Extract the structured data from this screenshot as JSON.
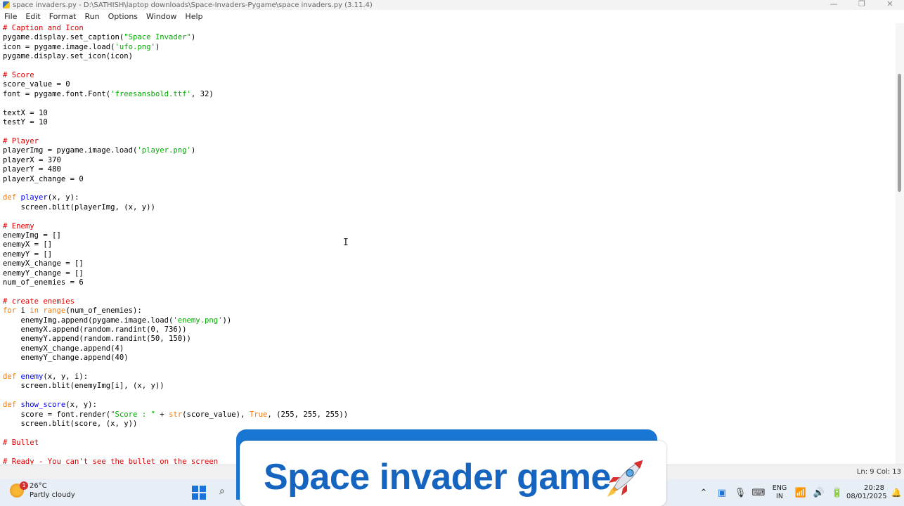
{
  "window": {
    "title": "space invaders.py - D:\\SATHISH\\laptop downloads\\Space-Invaders-Pygame\\space invaders.py (3.11.4)",
    "controls": [
      "—",
      "❐",
      "✕"
    ]
  },
  "menu": [
    "File",
    "Edit",
    "Format",
    "Run",
    "Options",
    "Window",
    "Help"
  ],
  "code_lines": [
    [
      [
        "cm",
        "# Caption and Icon"
      ]
    ],
    [
      [
        "",
        "pygame.display.set_caption("
      ],
      [
        "st",
        "\"Space Invader\""
      ],
      [
        "",
        ")"
      ]
    ],
    [
      [
        "",
        "icon = pygame.image.load("
      ],
      [
        "st",
        "'ufo.png'"
      ],
      [
        "",
        ")"
      ]
    ],
    [
      [
        "",
        "pygame.display.set_icon(icon)"
      ]
    ],
    [],
    [
      [
        "cm",
        "# Score"
      ]
    ],
    [
      [
        "",
        "score_value = 0"
      ]
    ],
    [
      [
        "",
        "font = pygame.font.Font("
      ],
      [
        "st",
        "'freesansbold.ttf'"
      ],
      [
        "",
        ", 32)"
      ]
    ],
    [],
    [
      [
        "",
        "textX = 10"
      ]
    ],
    [
      [
        "",
        "testY = 10"
      ]
    ],
    [],
    [
      [
        "cm",
        "# Player"
      ]
    ],
    [
      [
        "",
        "playerImg = pygame.image.load("
      ],
      [
        "st",
        "'player.png'"
      ],
      [
        "",
        ")"
      ]
    ],
    [
      [
        "",
        "playerX = 370"
      ]
    ],
    [
      [
        "",
        "playerY = 480"
      ]
    ],
    [
      [
        "",
        "playerX_change = 0"
      ]
    ],
    [],
    [
      [
        "kw",
        "def "
      ],
      [
        "fn",
        "player"
      ],
      [
        "",
        "(x, y):"
      ]
    ],
    [
      [
        "",
        "    screen.blit(playerImg, (x, y))"
      ]
    ],
    [],
    [
      [
        "cm",
        "# Enemy"
      ]
    ],
    [
      [
        "",
        "enemyImg = []"
      ]
    ],
    [
      [
        "",
        "enemyX = []"
      ]
    ],
    [
      [
        "",
        "enemyY = []"
      ]
    ],
    [
      [
        "",
        "enemyX_change = []"
      ]
    ],
    [
      [
        "",
        "enemyY_change = []"
      ]
    ],
    [
      [
        "",
        "num_of_enemies = 6"
      ]
    ],
    [],
    [
      [
        "cm",
        "# create enemies"
      ]
    ],
    [
      [
        "kw",
        "for "
      ],
      [
        "",
        "i "
      ],
      [
        "kw",
        "in "
      ],
      [
        "kw",
        "range"
      ],
      [
        "",
        "(num_of_enemies):"
      ]
    ],
    [
      [
        "",
        "    enemyImg.append(pygame.image.load("
      ],
      [
        "st",
        "'enemy.png'"
      ],
      [
        "",
        "))"
      ]
    ],
    [
      [
        "",
        "    enemyX.append(random.randint(0, 736))"
      ]
    ],
    [
      [
        "",
        "    enemyY.append(random.randint(50, 150))"
      ]
    ],
    [
      [
        "",
        "    enemyX_change.append(4)"
      ]
    ],
    [
      [
        "",
        "    enemyY_change.append(40)"
      ]
    ],
    [],
    [
      [
        "kw",
        "def "
      ],
      [
        "fn",
        "enemy"
      ],
      [
        "",
        "(x, y, i):"
      ]
    ],
    [
      [
        "",
        "    screen.blit(enemyImg[i], (x, y))"
      ]
    ],
    [],
    [
      [
        "kw",
        "def "
      ],
      [
        "fn",
        "show_score"
      ],
      [
        "",
        "(x, y):"
      ]
    ],
    [
      [
        "",
        "    score = font.render("
      ],
      [
        "st",
        "\"Score : \""
      ],
      [
        "",
        " + "
      ],
      [
        "kw",
        "str"
      ],
      [
        "",
        "(score_value), "
      ],
      [
        "kw",
        "True"
      ],
      [
        "",
        ", (255, 255, 255))"
      ]
    ],
    [
      [
        "",
        "    screen.blit(score, (x, y))"
      ]
    ],
    [],
    [
      [
        "cm",
        "# Bullet"
      ]
    ],
    [],
    [
      [
        "cm",
        "# Ready - You can't see the bullet on the screen"
      ]
    ]
  ],
  "status": {
    "position": "Ln: 9   Col: 13"
  },
  "taskbar": {
    "weather_badge": "1",
    "temperature": "26°C",
    "condition": "Partly cloudy",
    "lang_top": "ENG",
    "lang_bottom": "IN",
    "time": "20:28",
    "date": "08/01/2025"
  },
  "banner": {
    "title": "Space invader game"
  },
  "colors": {
    "keyword": "#ff7700",
    "comment": "#dd0000",
    "string": "#00aa00",
    "definition": "#0000ff",
    "banner_blue": "#1565c0"
  }
}
